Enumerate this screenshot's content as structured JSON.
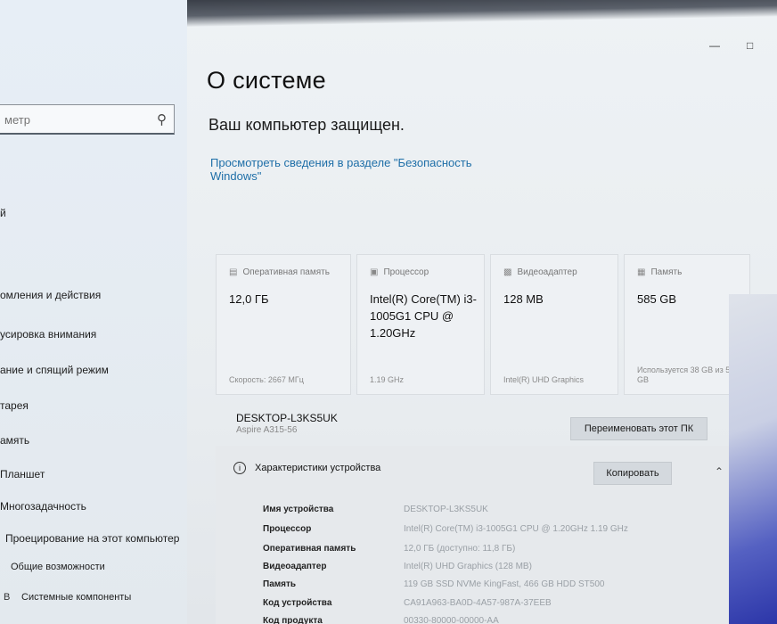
{
  "sidebar": {
    "search_placeholder": "метр",
    "items": [
      {
        "label": "й",
        "icon": ""
      },
      {
        "label": "омления и действия",
        "icon": ""
      },
      {
        "label": "усировка внимания",
        "icon": ""
      },
      {
        "label": "ание и спящий режим",
        "icon": ""
      },
      {
        "label": "тарея",
        "icon": ""
      },
      {
        "label": "амять",
        "icon": ""
      },
      {
        "label": "Планшет",
        "icon": ""
      },
      {
        "label": "Многозадачность",
        "icon": ""
      },
      {
        "label": "Проецирование на этот компьютер",
        "icon": ""
      },
      {
        "label": "Общие возможности",
        "icon": ""
      },
      {
        "label": "Системные компоненты",
        "icon": "В"
      }
    ]
  },
  "window": {
    "minimize_icon": "minimize-icon",
    "maximize_icon": "maximize-icon"
  },
  "main": {
    "title": "О системе",
    "subtitle": "Ваш компьютер защищен.",
    "security_link": "Просмотреть сведения в разделе \"Безопасность Windows\""
  },
  "cards": [
    {
      "caption": "Оперативная память",
      "value": "12,0 ГБ",
      "footer": "Скорость: 2667 МГц",
      "icon": "memory-icon"
    },
    {
      "caption": "Процессор",
      "value": "Intel(R) Core(TM) i3-1005G1 CPU @ 1.20GHz",
      "footer": "1.19 GHz",
      "icon": "cpu-icon"
    },
    {
      "caption": "Видеоадаптер",
      "value": "128 MB",
      "footer": "Intel(R) UHD Graphics",
      "icon": "gpu-icon"
    },
    {
      "caption": "Память",
      "value": "585 GB",
      "footer": "Используется 38 GB из 585 GB",
      "icon": "storage-icon"
    }
  ],
  "device": {
    "name": "DESKTOP-L3KS5UK",
    "model": "Aspire A315-56",
    "rename_button": "Переименовать этот ПК"
  },
  "specs": {
    "heading": "Характеристики устройства",
    "copy_button": "Копировать",
    "rows": [
      {
        "key": "Имя устройства",
        "value": "DESKTOP-L3KS5UK"
      },
      {
        "key": "Процессор",
        "value": "Intel(R) Core(TM) i3-1005G1 CPU @ 1.20GHz   1.19 GHz"
      },
      {
        "key": "Оперативная память",
        "value": "12,0 ГБ (доступно: 11,8 ГБ)"
      },
      {
        "key": "Видеоадаптер",
        "value": "Intel(R) UHD Graphics (128 MB)"
      },
      {
        "key": "Память",
        "value": "119 GB SSD NVMe KingFast, 466 GB HDD ST500"
      },
      {
        "key": "Код устройства",
        "value": "CA91A963-BA0D-4A57-987A-37EEB"
      },
      {
        "key": "Код продукта",
        "value": "00330-80000-00000-AA"
      }
    ]
  },
  "colors": {
    "link": "#1f6fa8",
    "accent_wallpaper": "#2b35a8"
  }
}
